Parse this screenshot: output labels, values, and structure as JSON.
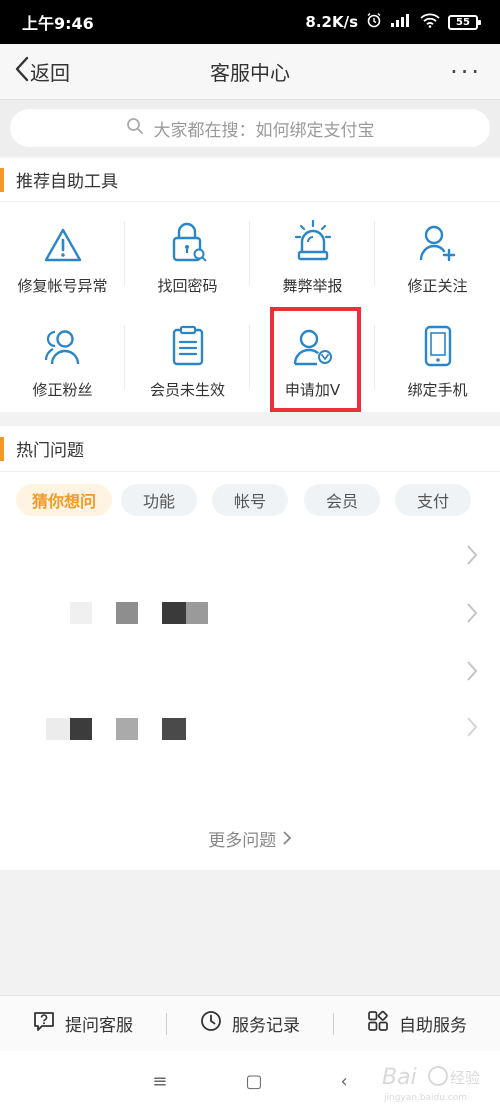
{
  "status_bar": {
    "time": "上午9:46",
    "speed": "8.2K/s",
    "battery": "55",
    "icons": [
      "alarm-icon",
      "signal-icon",
      "wifi-icon",
      "battery-icon"
    ]
  },
  "nav": {
    "back_label": "返回",
    "title": "客服中心",
    "more_label": "···"
  },
  "search": {
    "placeholder": "大家都在搜：如何绑定支付宝"
  },
  "tools_section": {
    "title": "推荐自助工具",
    "items": [
      {
        "label": "修复帐号异常",
        "icon": "warning-triangle-icon"
      },
      {
        "label": "找回密码",
        "icon": "lock-search-icon"
      },
      {
        "label": "舞弊举报",
        "icon": "alarm-siren-icon"
      },
      {
        "label": "修正关注",
        "icon": "user-plus-icon"
      },
      {
        "label": "修正粉丝",
        "icon": "users-icon"
      },
      {
        "label": "会员未生效",
        "icon": "clipboard-icon"
      },
      {
        "label": "申请加V",
        "icon": "user-verified-icon"
      },
      {
        "label": "绑定手机",
        "icon": "phone-icon"
      }
    ]
  },
  "hot_section": {
    "title": "热门问题",
    "tabs": [
      {
        "label": "猜你想问",
        "active": true
      },
      {
        "label": "功能",
        "active": false
      },
      {
        "label": "帐号",
        "active": false
      },
      {
        "label": "会员",
        "active": false
      },
      {
        "label": "支付",
        "active": false
      }
    ],
    "more_label": "更多问题"
  },
  "bottom_bar": {
    "items": [
      {
        "label": "提问客服",
        "icon": "question-bubble-icon"
      },
      {
        "label": "服务记录",
        "icon": "clock-icon"
      },
      {
        "label": "自助服务",
        "icon": "grid-apps-icon"
      }
    ]
  },
  "system_nav": {
    "menu": "≡",
    "home": "▢",
    "back": "‹"
  },
  "colors": {
    "accent": "#f39a26",
    "icon_blue": "#2a86c8",
    "highlight_red": "#ec2f3a"
  }
}
